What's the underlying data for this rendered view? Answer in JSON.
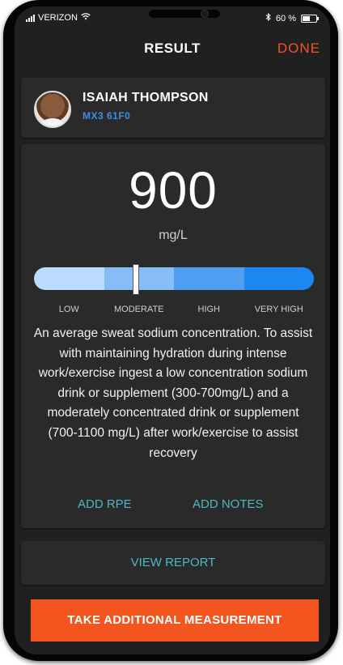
{
  "status_bar": {
    "carrier": "VERIZON",
    "wifi_icon": "wifi-icon",
    "bluetooth_icon": "bluetooth-icon",
    "battery_text": "60 %"
  },
  "header": {
    "title": "RESULT",
    "done_label": "DONE",
    "accent_color": "#f25522"
  },
  "user": {
    "name": "ISAIAH THOMPSON",
    "device": "MX3 61F0",
    "device_color": "#3b8fe0"
  },
  "result": {
    "value": "900",
    "unit": "mg/L",
    "indicator_level": 0.36,
    "scale": [
      {
        "label": "LOW",
        "color": "#bcdcff"
      },
      {
        "label": "MODERATE",
        "color": "#86bdf7"
      },
      {
        "label": "HIGH",
        "color": "#4f9ef0"
      },
      {
        "label": "VERY HIGH",
        "color": "#1c86f2"
      }
    ],
    "description": "An average sweat sodium concentration. To assist with maintaining hydration during intense work/exercise ingest a low concentration sodium drink or supplement (300-700mg/L) and a moderately concentrated drink or supplement (700-1100 mg/L) after work/exercise to assist recovery",
    "add_rpe_label": "ADD RPE",
    "add_notes_label": "ADD NOTES",
    "link_color": "#4fb6c7"
  },
  "report": {
    "view_report_label": "VIEW REPORT"
  },
  "cta": {
    "label": "TAKE ADDITIONAL MEASUREMENT",
    "color": "#f2561e"
  }
}
